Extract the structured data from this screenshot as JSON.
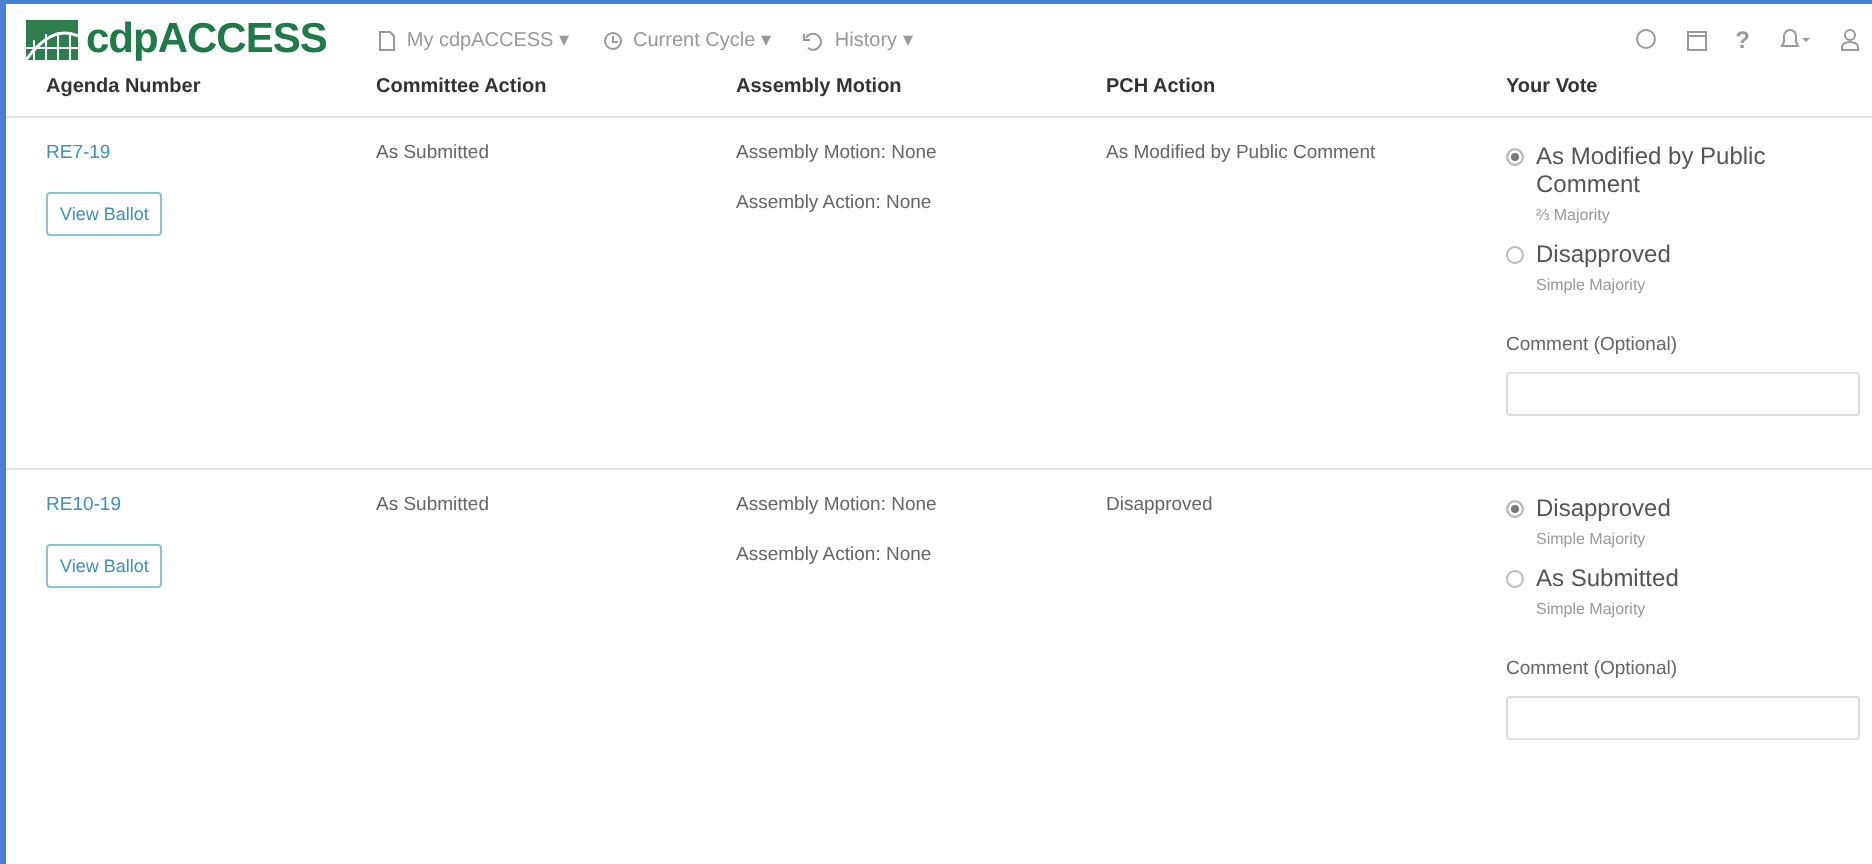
{
  "brand": {
    "name": "cdpACCESS"
  },
  "nav_menus": [
    {
      "label": "My cdpACCESS ▾"
    },
    {
      "label": "Current Cycle ▾"
    },
    {
      "label": "History ▾"
    }
  ],
  "help": "?",
  "table": {
    "columns": [
      "Agenda Number",
      "Committee Action",
      "Assembly Motion",
      "PCH Action",
      "Your Vote"
    ],
    "rows": [
      {
        "agenda": "RE7-19",
        "button": "View Ballot",
        "committee_action": "As Submitted",
        "assembly": [
          "Assembly Motion: None",
          "Assembly Action: None"
        ],
        "pch_action": "As Modified by Public Comment",
        "votes": [
          {
            "label": "As Modified by Public Comment",
            "note": "⅔ Majority",
            "selected": true
          },
          {
            "label": "Disapproved",
            "note": "Simple Majority",
            "selected": false
          }
        ],
        "comment_label": "Comment (Optional)"
      },
      {
        "agenda": "RE10-19",
        "button": "View Ballot",
        "committee_action": "As Submitted",
        "assembly": [
          "Assembly Motion: None",
          "Assembly Action: None"
        ],
        "pch_action": "Disapproved",
        "votes": [
          {
            "label": "Disapproved",
            "note": "Simple Majority",
            "selected": true
          },
          {
            "label": "As Submitted",
            "note": "Simple Majority",
            "selected": false
          }
        ],
        "comment_label": "Comment (Optional)"
      }
    ]
  }
}
